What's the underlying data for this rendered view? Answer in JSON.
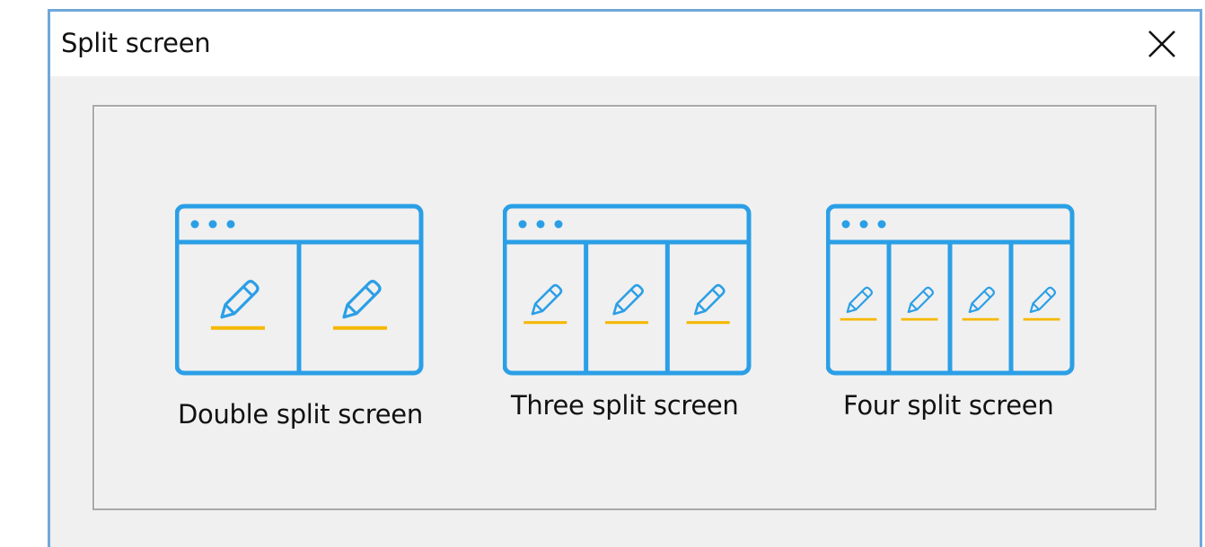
{
  "dialog": {
    "title": "Split screen",
    "close_icon": "close-icon"
  },
  "options": [
    {
      "label": "Double split screen",
      "panes": 2,
      "icon": "pencil-icon"
    },
    {
      "label": "Three split screen",
      "panes": 3,
      "icon": "pencil-icon"
    },
    {
      "label": "Four split screen",
      "panes": 4,
      "icon": "pencil-icon"
    }
  ],
  "colors": {
    "accent_blue": "#2b9fe6",
    "underline_yellow": "#f5b800",
    "window_border": "#6fa8dc"
  }
}
